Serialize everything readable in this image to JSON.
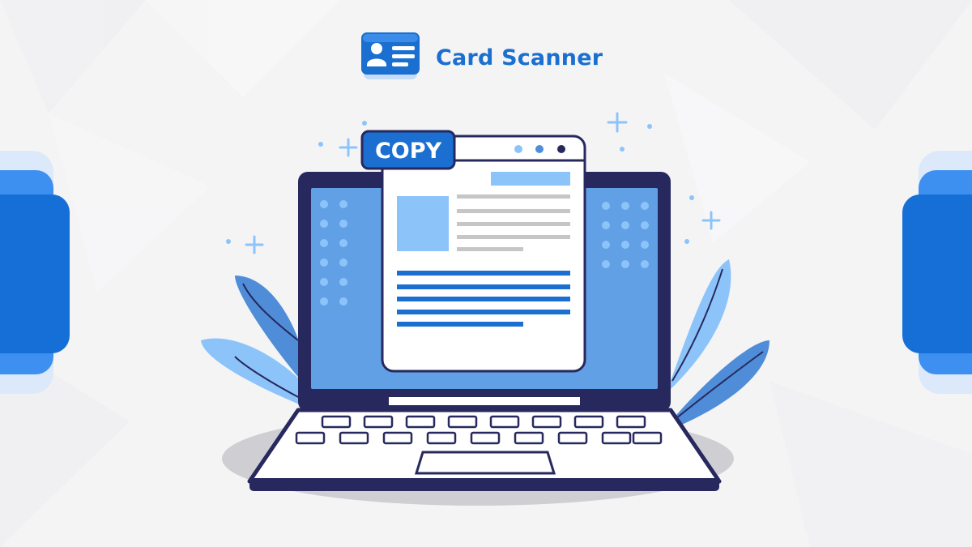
{
  "brand": {
    "name": "Card Scanner",
    "logo_icon": "id-card-icon"
  },
  "badge": {
    "text": "COPY"
  },
  "illustration": {
    "subject": "laptop-with-document-window-icon",
    "colors": {
      "brand_blue": "#1a6fd0",
      "navy": "#27295e",
      "screen_blue": "#62a0e6",
      "light_blue": "#8cc4fa",
      "leaf_blue": "#4f8dd8",
      "gray_line": "#c6c6c6"
    }
  }
}
